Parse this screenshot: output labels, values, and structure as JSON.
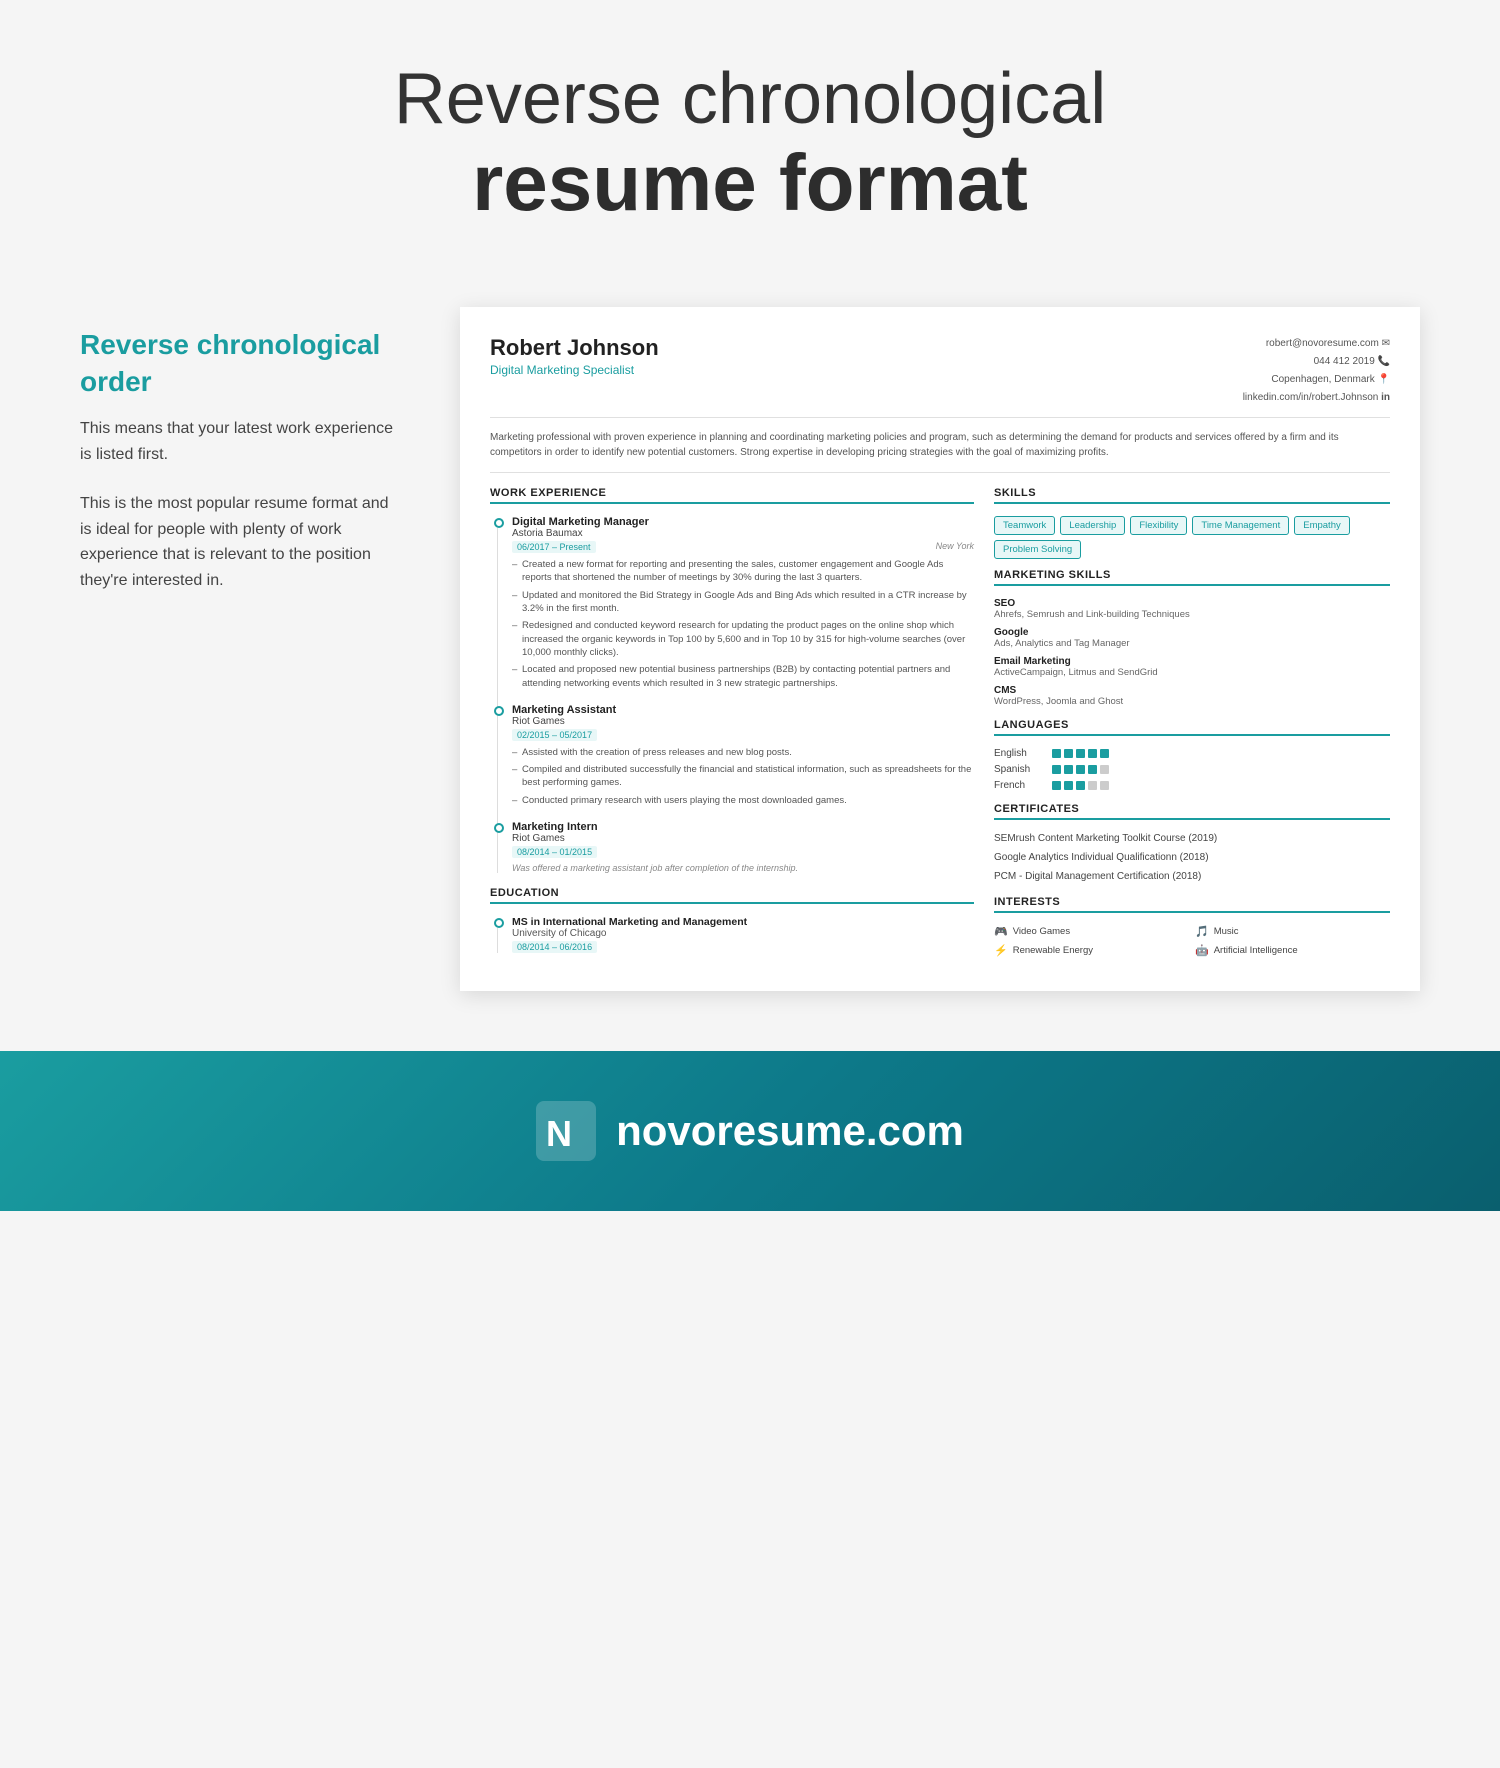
{
  "page": {
    "title_light": "Reverse chronological",
    "title_bold": "resume format"
  },
  "sidebar": {
    "heading": "Reverse chronological order",
    "para1": "This means that your latest work experience is listed first.",
    "para2": "This is the most popular resume format and is ideal for people with plenty of work experience that is relevant to the position they're interested in."
  },
  "resume": {
    "name": "Robert Johnson",
    "title": "Digital Marketing Specialist",
    "contact": {
      "email": "robert@novoresume.com",
      "phone": "044 412 2019",
      "location": "Copenhagen, Denmark",
      "linkedin": "linkedin.com/in/robert.Johnson"
    },
    "summary": "Marketing professional with proven experience in planning and coordinating marketing policies and program, such as determining the demand for products and services offered by a firm and its competitors in order to identify new potential customers. Strong expertise in developing pricing strategies with the goal of maximizing profits.",
    "sections": {
      "work_experience_label": "WORK EXPERIENCE",
      "skills_label": "SKILLS",
      "marketing_skills_label": "MARKETING SKILLS",
      "languages_label": "LANGUAGES",
      "certificates_label": "CERTIFICATES",
      "interests_label": "INTERESTS",
      "education_label": "EDUCATION"
    },
    "work_experience": [
      {
        "title": "Digital Marketing Manager",
        "company": "Astoria Baumax",
        "date": "06/2017 – Present",
        "location": "New York",
        "bullets": [
          "Created a new format for reporting and presenting the sales, customer engagement and Google Ads reports that shortened the number of meetings by 30% during the last 3 quarters.",
          "Updated and monitored the Bid Strategy in Google Ads and Bing Ads which resulted in a CTR increase by 3.2% in the first month.",
          "Redesigned and conducted keyword research for updating the product pages on the online shop which increased the organic keywords in Top 100 by 5,600 and in Top 10 by 315 for high-volume searches (over 10,000 monthly clicks).",
          "Located and proposed new potential business partnerships (B2B) by contacting potential partners and attending networking events which resulted in 3 new strategic partnerships."
        ]
      },
      {
        "title": "Marketing Assistant",
        "company": "Riot Games",
        "date": "02/2015 – 05/2017",
        "location": "",
        "bullets": [
          "Assisted with the creation of press releases and new blog posts.",
          "Compiled and distributed successfully the financial and statistical information, such as spreadsheets for the best performing games.",
          "Conducted primary research with users playing the most downloaded games."
        ]
      },
      {
        "title": "Marketing Intern",
        "company": "Riot Games",
        "date": "08/2014 – 01/2015",
        "location": "",
        "italic": "Was offered a marketing assistant job after completion of the internship.",
        "bullets": []
      }
    ],
    "education": [
      {
        "degree": "MS in International Marketing and Management",
        "school": "University of Chicago",
        "date": "08/2014 – 06/2016"
      }
    ],
    "skills": [
      "Teamwork",
      "Leadership",
      "Flexibility",
      "Time Management",
      "Empathy",
      "Problem Solving"
    ],
    "marketing_skills": [
      {
        "name": "SEO",
        "desc": "Ahrefs, Semrush and Link-building Techniques"
      },
      {
        "name": "Google",
        "desc": "Ads, Analytics and Tag Manager"
      },
      {
        "name": "Email Marketing",
        "desc": "ActiveCampaign, Litmus and SendGrid"
      },
      {
        "name": "CMS",
        "desc": "WordPress, Joomla and Ghost"
      }
    ],
    "languages": [
      {
        "name": "English",
        "level": 5
      },
      {
        "name": "Spanish",
        "level": 4
      },
      {
        "name": "French",
        "level": 3
      }
    ],
    "certificates": [
      "SEMrush Content Marketing Toolkit Course (2019)",
      "Google Analytics Individual Qualificationn (2018)",
      "PCM - Digital Management Certification (2018)"
    ],
    "interests": [
      {
        "icon": "🎮",
        "label": "Video Games"
      },
      {
        "icon": "🎵",
        "label": "Music"
      },
      {
        "icon": "⚡",
        "label": "Renewable Energy"
      },
      {
        "icon": "🤖",
        "label": "Artificial Intelligence"
      }
    ]
  },
  "footer": {
    "brand": "novoresume.com"
  }
}
